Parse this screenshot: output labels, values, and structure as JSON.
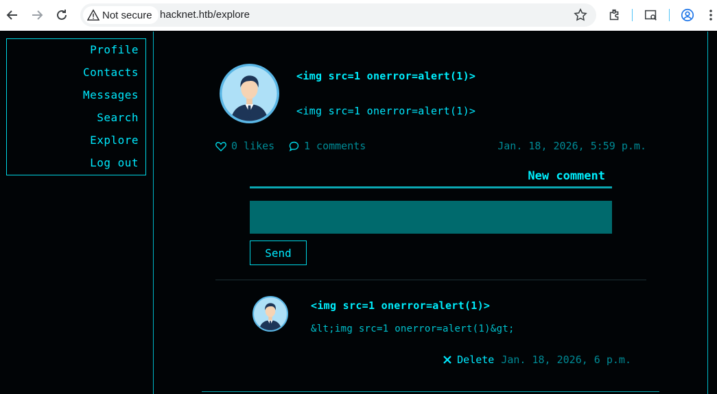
{
  "browser": {
    "security_label": "Not secure",
    "url_host": "hacknet.htb",
    "url_path": "/explore"
  },
  "sidebar": {
    "items": [
      {
        "label": "Profile"
      },
      {
        "label": "Contacts"
      },
      {
        "label": "Messages"
      },
      {
        "label": "Search"
      },
      {
        "label": "Explore"
      },
      {
        "label": "Log out"
      }
    ]
  },
  "post": {
    "author": "<img src=1 onerror=alert(1)>",
    "body": "<img src=1 onerror=alert(1)>",
    "likes": "0 likes",
    "comments": "1 comments",
    "date": "Jan. 18, 2026, 5:59 p.m."
  },
  "comment_form": {
    "title": "New comment",
    "input_value": "",
    "send_label": "Send"
  },
  "comment": {
    "author": "<img src=1 onerror=alert(1)>",
    "body": "&lt;img src=1 onerror=alert(1)&gt;",
    "delete_label": "Delete",
    "date": "Jan. 18, 2026, 6 p.m."
  },
  "colors": {
    "accent": "#00eaff",
    "muted": "#008b96",
    "input_bg": "#006a6d",
    "page_bg": "#010406"
  }
}
